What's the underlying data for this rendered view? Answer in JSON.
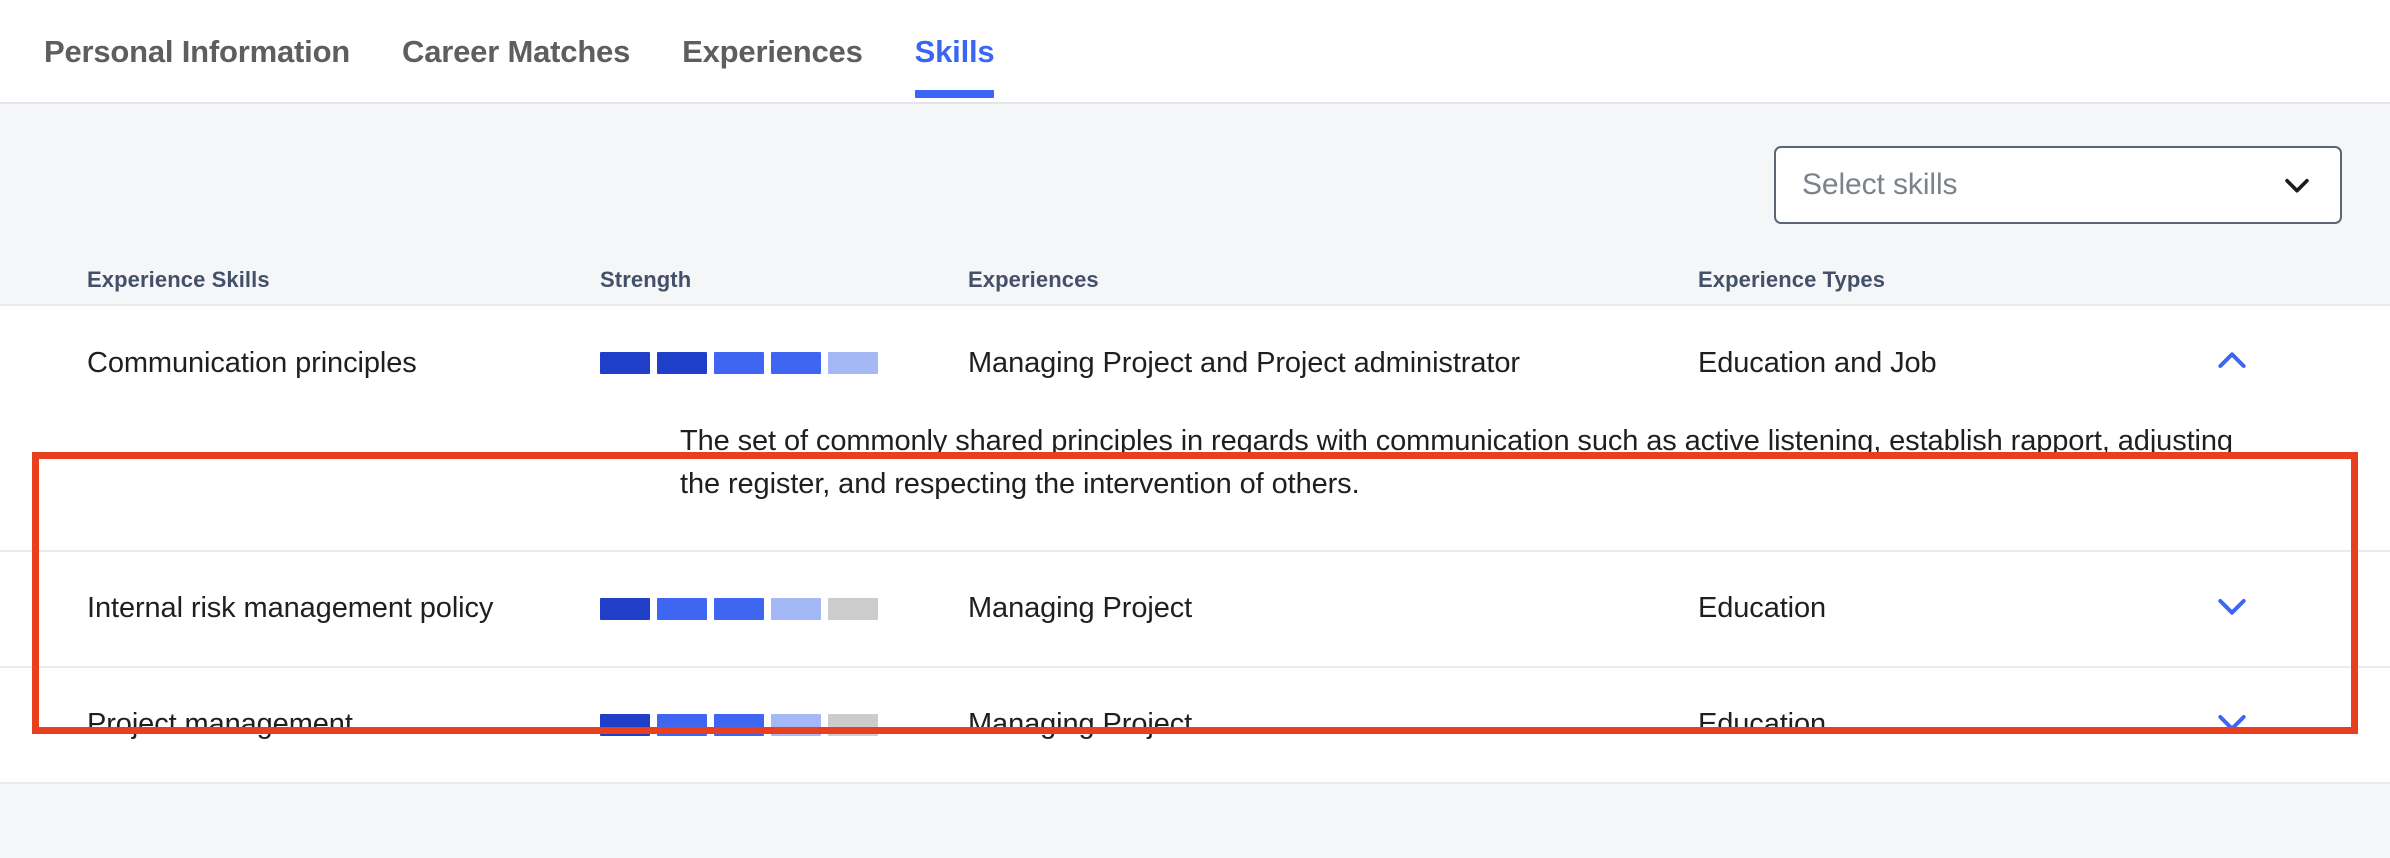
{
  "tabs": [
    {
      "label": "Personal Information",
      "active": false
    },
    {
      "label": "Career Matches",
      "active": false
    },
    {
      "label": "Experiences",
      "active": false
    },
    {
      "label": "Skills",
      "active": true
    }
  ],
  "colors": {
    "accent_blue": "#3b66f5",
    "bar_dark": "#1f3fc9",
    "bar_medium": "#3f66f0",
    "bar_light": "#a4b8f5",
    "bar_empty": "#cccccc",
    "highlight_red": "#e8401f",
    "header_text": "#44506a",
    "page_bg": "#f4f6f8"
  },
  "toolbar": {
    "select_skills": {
      "placeholder": "Select skills",
      "value": "",
      "icon": "chevron-down-icon"
    }
  },
  "table": {
    "headers": [
      "Experience Skills",
      "Strength",
      "Experiences",
      "Experience Types"
    ],
    "rows": [
      {
        "skill": "Communication principles",
        "strength": [
          4,
          4,
          3,
          3,
          2
        ],
        "strength_filled": 4,
        "experiences": "Managing Project and Project administrator",
        "experience_types": "Education and Job",
        "expanded": true,
        "toggle_icon": "chevron-up-icon",
        "description": "The set of commonly shared principles in regards with communication such as active listening, establish rapport, adjusting the register, and respecting the intervention of others.",
        "highlighted": true
      },
      {
        "skill": "Internal risk management policy",
        "strength": [
          4,
          3,
          3,
          2,
          1
        ],
        "strength_filled": 3,
        "experiences": "Managing Project",
        "experience_types": "Education",
        "expanded": false,
        "toggle_icon": "chevron-down-icon",
        "description": "",
        "highlighted": false
      },
      {
        "skill": "Project management",
        "strength": [
          4,
          3,
          3,
          2,
          1
        ],
        "strength_filled": 3,
        "experiences": "Managing Project",
        "experience_types": "Education",
        "expanded": false,
        "toggle_icon": "chevron-down-icon",
        "description": "",
        "highlighted": false
      }
    ]
  }
}
